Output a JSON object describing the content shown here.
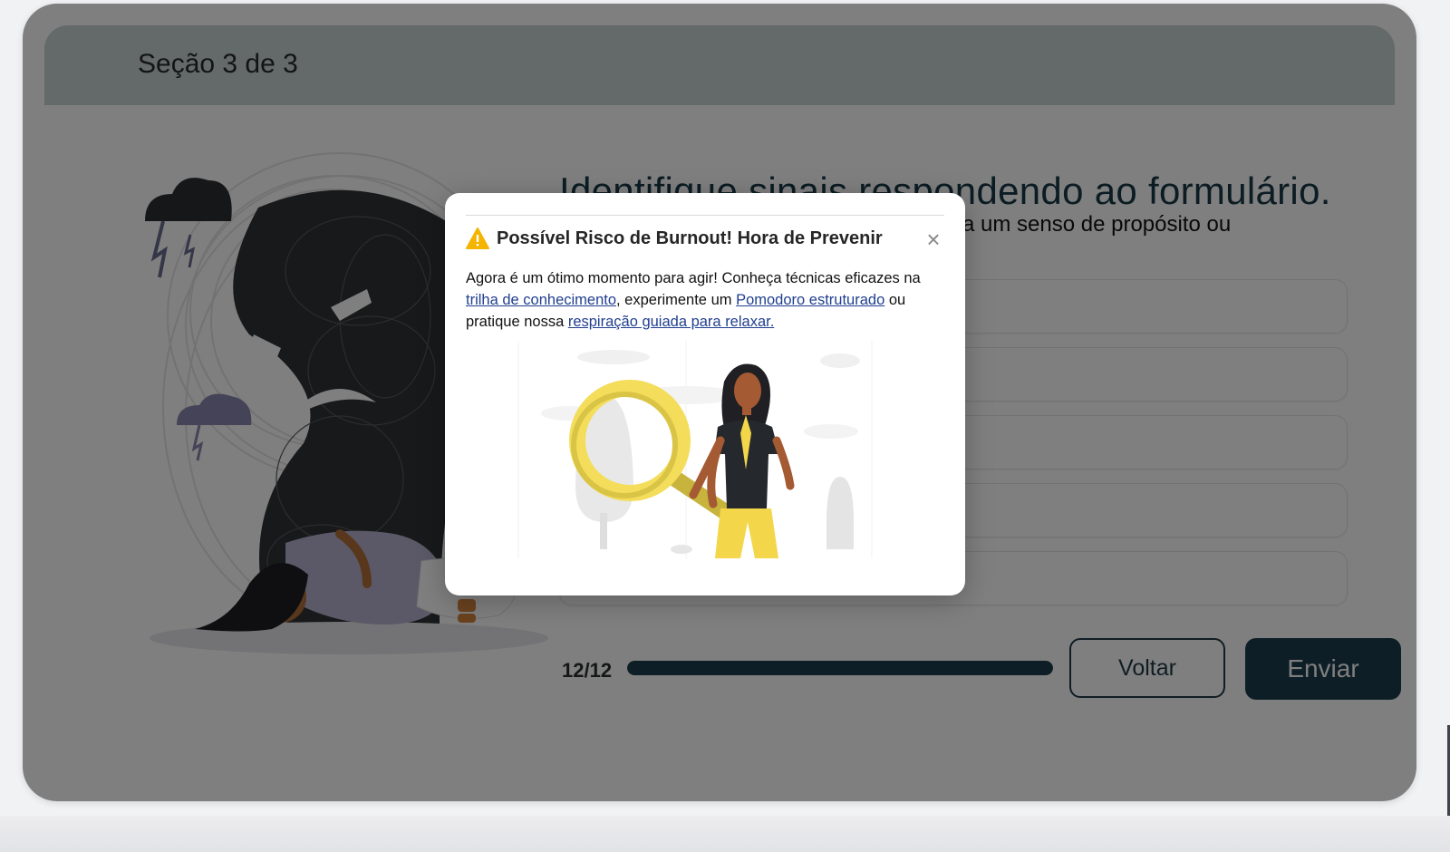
{
  "header": {
    "section": "Seção 3 de 3"
  },
  "form": {
    "title": "Identifique sinais respondendo ao formulário.",
    "question_visible": "a um senso de propósito ou",
    "options_count": 5
  },
  "progress": {
    "counter": "12/12",
    "fraction": 1.0
  },
  "buttons": {
    "back": "Voltar",
    "send": "Enviar"
  },
  "modal": {
    "title": "Possível Risco de Burnout! Hora de Prevenir",
    "close": "×",
    "body": {
      "text1": "Agora é um ótimo momento para agir! Conheça técnicas eficazes na ",
      "link1": "trilha de conhecimento",
      "text2": ", experimente um ",
      "link2": "Pomodoro estruturado",
      "text3": " ou pratique nossa ",
      "link3": "respiração guiada para relaxar."
    }
  },
  "icons": {
    "warning": "warning-icon",
    "close": "close-icon"
  },
  "colors": {
    "primary": "#1b3d4c",
    "header_bg": "#c8d3d4",
    "link": "#203f8f",
    "warning": "#f4b400"
  }
}
